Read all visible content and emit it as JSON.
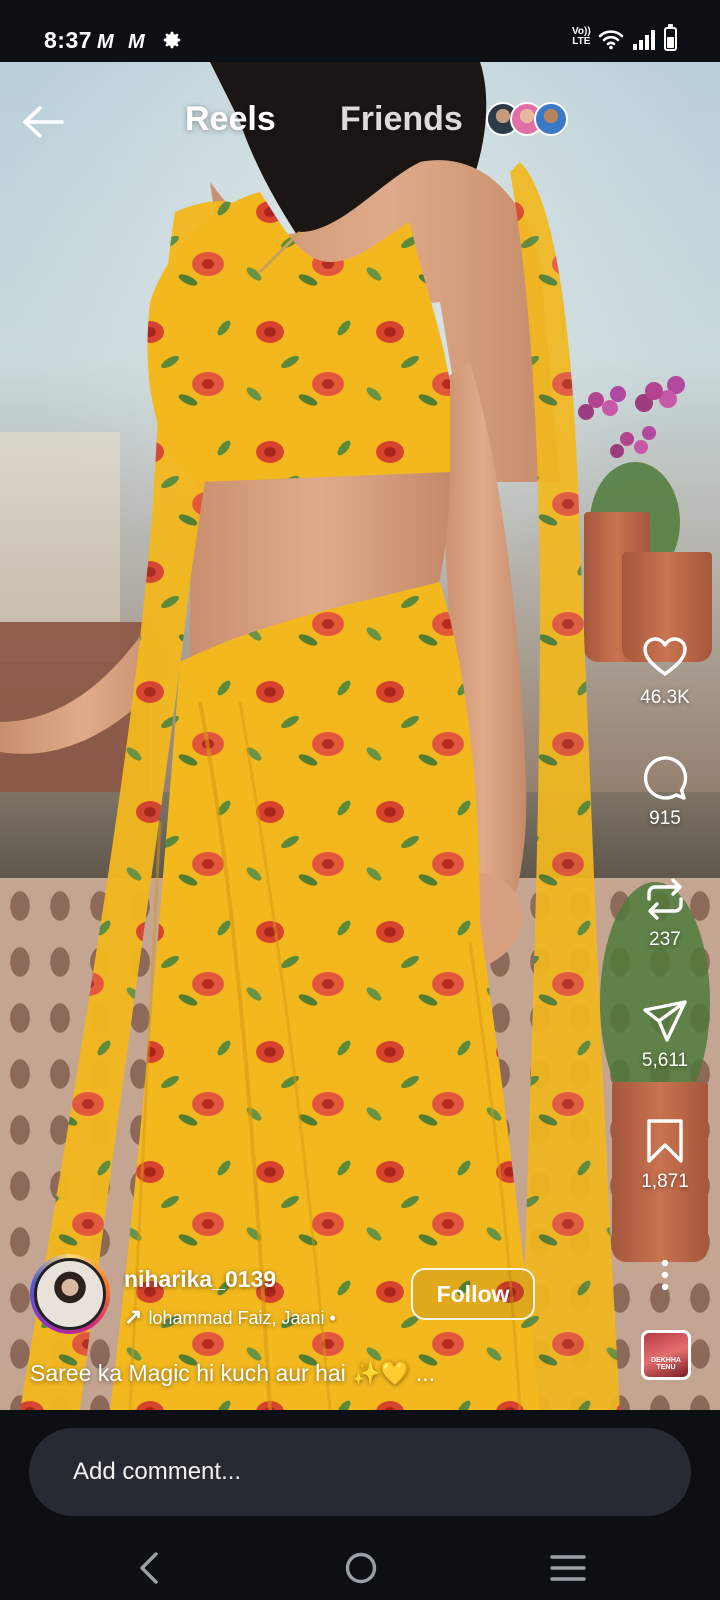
{
  "status_bar": {
    "time": "8:37",
    "notif_1": "M",
    "notif_2": "M",
    "settings_icon": "gear-icon",
    "volte_line1": "Vo))",
    "volte_line2": "LTE",
    "wifi_icon": "wifi-icon",
    "signal_icon": "signal-icon",
    "battery_icon": "battery-icon"
  },
  "header": {
    "back_icon": "arrow-left-icon",
    "tabs": [
      {
        "label": "Reels",
        "active": true
      },
      {
        "label": "Friends",
        "active": false
      }
    ],
    "friend_avatars": 3
  },
  "actions": [
    {
      "id": "like",
      "icon": "heart-icon",
      "count": "46.3K"
    },
    {
      "id": "comment",
      "icon": "comment-bubble-icon",
      "count": "915"
    },
    {
      "id": "remix",
      "icon": "repost-icon",
      "count": "237"
    },
    {
      "id": "share",
      "icon": "send-icon",
      "count": "5,611"
    },
    {
      "id": "save",
      "icon": "bookmark-icon",
      "count": "1,871"
    }
  ],
  "more_icon": "more-vertical-icon",
  "audio_thumb": {
    "text": "DEKHHA TENU"
  },
  "post": {
    "username": "niharika_0139",
    "audio_text": "lohammad Faiz, Jaani •",
    "follow_label": "Follow",
    "caption": "Saree ka Magic hi kuch aur hai ✨💛 ..."
  },
  "comment": {
    "placeholder": "Add comment..."
  },
  "nav_bar": {
    "back_icon": "nav-back-icon",
    "home_icon": "nav-home-icon",
    "recents_icon": "nav-recents-icon"
  },
  "colors": {
    "background": "#0c0f14",
    "comment_box": "#262a33",
    "saree_yellow": "#f2b81e",
    "flower_red": "#d8432f"
  }
}
